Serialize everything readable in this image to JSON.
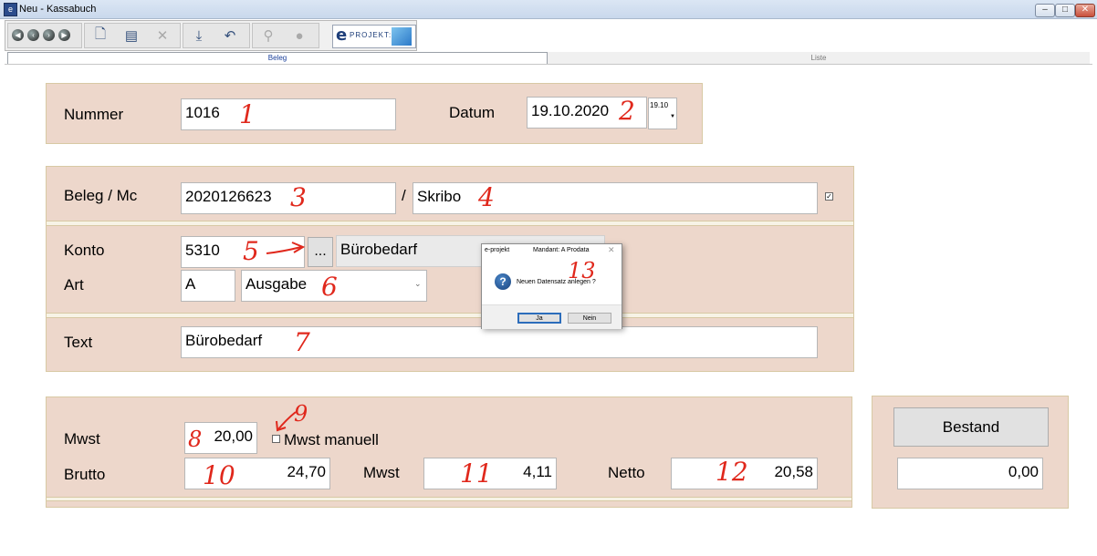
{
  "window": {
    "title": "Neu - Kassabuch"
  },
  "toolbar": {
    "logo_letter": "e",
    "logo_text": "PROJEKT:"
  },
  "tabs": [
    {
      "label": "Beleg",
      "active": true
    },
    {
      "label": "Liste",
      "active": false
    }
  ],
  "form": {
    "nummer": {
      "label": "Nummer",
      "value": "1016"
    },
    "datum": {
      "label": "Datum",
      "value": "19.10.2020",
      "picker_text": "19.10"
    },
    "beleg": {
      "label": "Beleg  / Mc",
      "value": "2020126623",
      "separator": "/",
      "mc_value": "Skribo"
    },
    "konto": {
      "label": "Konto",
      "value": "5310",
      "lookup_label": "...",
      "description": "Bürobedarf"
    },
    "art": {
      "label": "Art",
      "code": "A",
      "selected": "Ausgabe"
    },
    "text": {
      "label": "Text",
      "value": "Bürobedarf"
    },
    "mwst": {
      "label": "Mwst",
      "value": "20,00",
      "manual_label": "Mwst manuell"
    },
    "brutto": {
      "label": "Brutto",
      "value": "24,70"
    },
    "mwst_amount": {
      "label": "Mwst",
      "value": "4,11"
    },
    "netto": {
      "label": "Netto",
      "value": "20,58"
    },
    "bestand": {
      "button_label": "Bestand",
      "value": "0,00"
    }
  },
  "annotations": [
    "1",
    "2",
    "3",
    "4",
    "5",
    "6",
    "7",
    "8",
    "9",
    "10",
    "11",
    "12",
    "13"
  ],
  "dialog": {
    "title": "e-projekt",
    "mandant": "Mandant:  A  Prodata",
    "message": "Neuen Datensatz anlegen ?",
    "yes_label": "Ja",
    "no_label": "Nein"
  },
  "colors": {
    "panel": "#edd7cb",
    "annotation": "#e0281c",
    "accent": "#2c6dbb"
  }
}
